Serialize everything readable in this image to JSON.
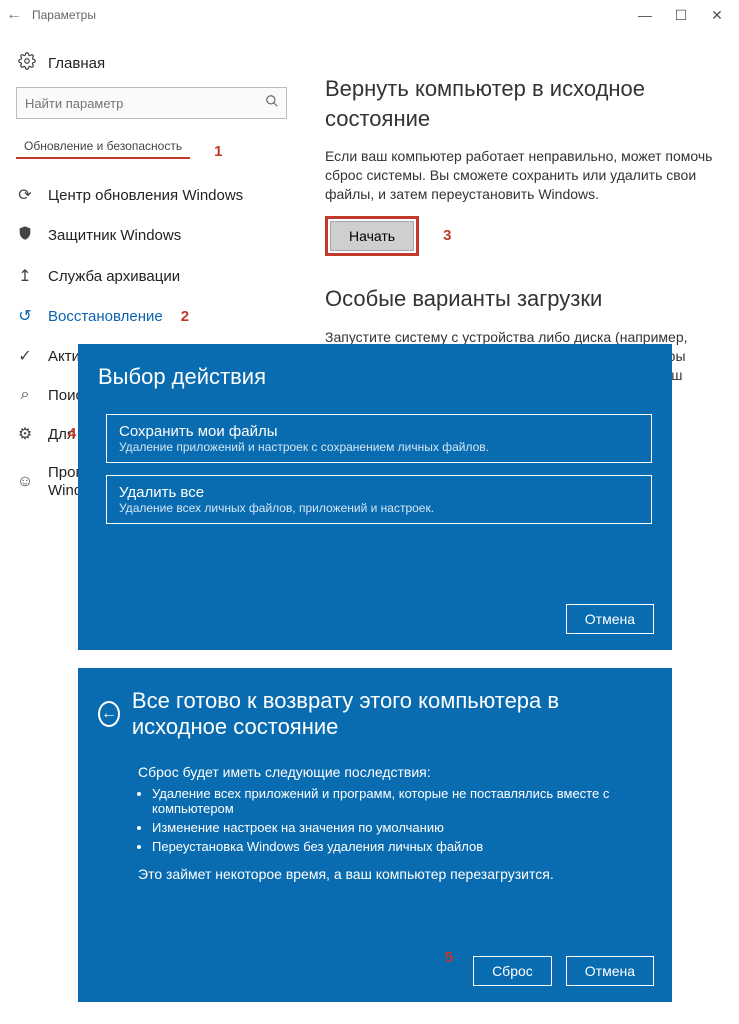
{
  "window": {
    "title": "Параметры"
  },
  "sidebar": {
    "home": "Главная",
    "search_placeholder": "Найти параметр",
    "section_label": "Обновление и безопасность",
    "items": [
      {
        "icon": "sync",
        "label": "Центр обновления Windows"
      },
      {
        "icon": "shield",
        "label": "Защитник Windows"
      },
      {
        "icon": "archive",
        "label": "Служба архивации"
      },
      {
        "icon": "history",
        "label": "Восстановление",
        "selected": true
      },
      {
        "icon": "check",
        "label": "Активация"
      },
      {
        "icon": "search2",
        "label": "Поиск"
      },
      {
        "icon": "dev",
        "label": "Для разработчиков"
      },
      {
        "icon": "insider",
        "label": "Программа предварительной оценки Windows"
      }
    ]
  },
  "content": {
    "reset": {
      "heading": "Вернуть компьютер в исходное состояние",
      "text": "Если ваш компьютер работает неправильно, может помочь сброс системы. Вы сможете сохранить или удалить свои файлы, и затем переустановить Windows.",
      "button": "Начать"
    },
    "advanced": {
      "heading": "Особые варианты загрузки",
      "text": "Запустите систему с устройства либо диска (например, USB-накопителя или DVD-диска), измените параметры загрузки Windows или восстановите ее из образа. Ваш компьютер"
    }
  },
  "dialog_choose": {
    "title": "Выбор действия",
    "options": [
      {
        "title": "Сохранить мои файлы",
        "sub": "Удаление приложений и настроек с сохранением личных файлов."
      },
      {
        "title": "Удалить все",
        "sub": "Удаление всех личных файлов, приложений и настроек."
      }
    ],
    "cancel": "Отмена"
  },
  "dialog_ready": {
    "title": "Все готово к возврату этого компьютера в исходное состояние",
    "intro": "Сброс будет иметь следующие последствия:",
    "bullets": [
      "Удаление всех приложений и программ, которые не поставлялись вместе с компьютером",
      "Изменение настроек на значения по умолчанию",
      "Переустановка Windows без удаления личных файлов"
    ],
    "after": "Это займет некоторое время, а ваш компьютер перезагрузится.",
    "reset": "Сброс",
    "cancel": "Отмена"
  },
  "annotations": {
    "a1": "1",
    "a2": "2",
    "a3": "3",
    "a4": "4",
    "a5": "5"
  }
}
